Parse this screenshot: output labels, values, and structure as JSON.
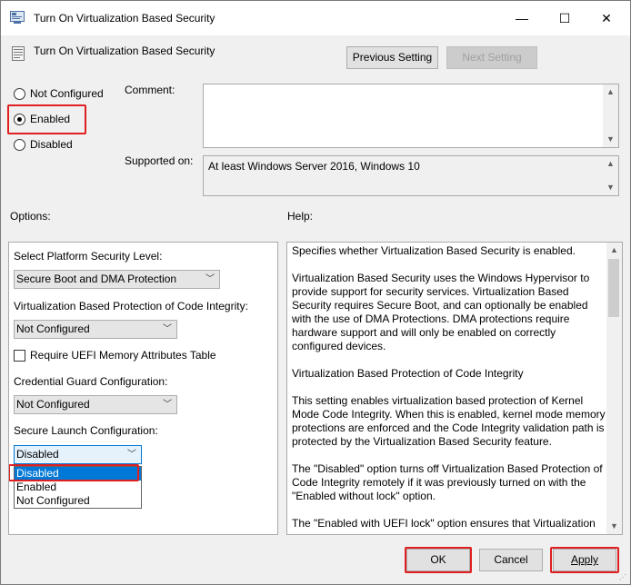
{
  "window": {
    "title": "Turn On Virtualization Based Security",
    "minimize": "—",
    "maximize": "☐",
    "close": "✕"
  },
  "header": {
    "policy_title": "Turn On Virtualization Based Security",
    "prev_button": "Previous Setting",
    "next_button": "Next Setting"
  },
  "state": {
    "options": [
      {
        "label": "Not Configured",
        "checked": false
      },
      {
        "label": "Enabled",
        "checked": true
      },
      {
        "label": "Disabled",
        "checked": false
      }
    ]
  },
  "comment": {
    "label": "Comment:",
    "value": ""
  },
  "supported": {
    "label": "Supported on:",
    "value": "At least Windows Server 2016, Windows 10"
  },
  "options_label": "Options:",
  "help_label": "Help:",
  "options_panel": {
    "platform_label": "Select Platform Security Level:",
    "platform_value": "Secure Boot and DMA Protection",
    "code_integrity_label": "Virtualization Based Protection of Code Integrity:",
    "code_integrity_value": "Not Configured",
    "uefi_checkbox_label": "Require UEFI Memory Attributes Table",
    "credential_guard_label": "Credential Guard Configuration:",
    "credential_guard_value": "Not Configured",
    "secure_launch_label": "Secure Launch Configuration:",
    "secure_launch_value": "Disabled",
    "secure_launch_options": [
      "Disabled",
      "Enabled",
      "Not Configured"
    ]
  },
  "help_panel": {
    "paragraphs": [
      "Specifies whether Virtualization Based Security is enabled.",
      "Virtualization Based Security uses the Windows Hypervisor to provide support for security services. Virtualization Based Security requires Secure Boot, and can optionally be enabled with the use of DMA Protections. DMA protections require hardware support and will only be enabled on correctly configured devices.",
      "Virtualization Based Protection of Code Integrity",
      "This setting enables virtualization based protection of Kernel Mode Code Integrity. When this is enabled, kernel mode memory protections are enforced and the Code Integrity validation path is protected by the Virtualization Based Security feature.",
      "The \"Disabled\" option turns off Virtualization Based Protection of Code Integrity remotely if it was previously turned on with the \"Enabled without lock\" option.",
      "The \"Enabled with UEFI lock\" option ensures that Virtualization"
    ]
  },
  "footer": {
    "ok": "OK",
    "cancel": "Cancel",
    "apply": "Apply"
  },
  "colors": {
    "highlight": "#e02020",
    "selection": "#0078d7"
  }
}
